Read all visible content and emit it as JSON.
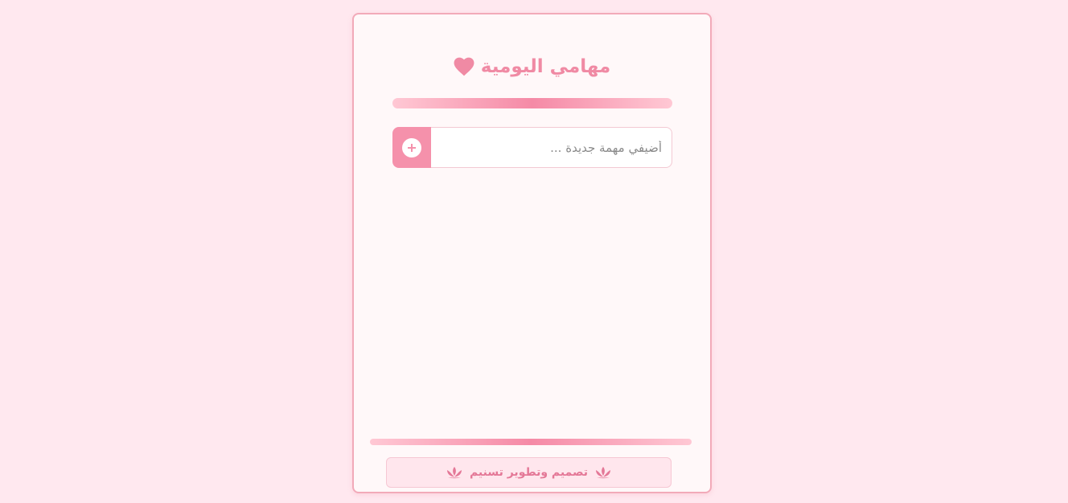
{
  "header": {
    "title": "مهامي اليومية",
    "icon": "heart-icon"
  },
  "task_input": {
    "placeholder": "أضيفي مهمة جديدة ...",
    "value": "",
    "add_button_icon": "plus-circle-icon"
  },
  "task_list": {
    "items": []
  },
  "footer": {
    "text": "تصميم وتطوير تسنيم",
    "icon": "lotus-icon"
  },
  "colors": {
    "background": "#ffe8ef",
    "card": "#fff8f9",
    "accent": "#f591ab",
    "title": "#f08aa4",
    "footer_text": "#e47897"
  }
}
